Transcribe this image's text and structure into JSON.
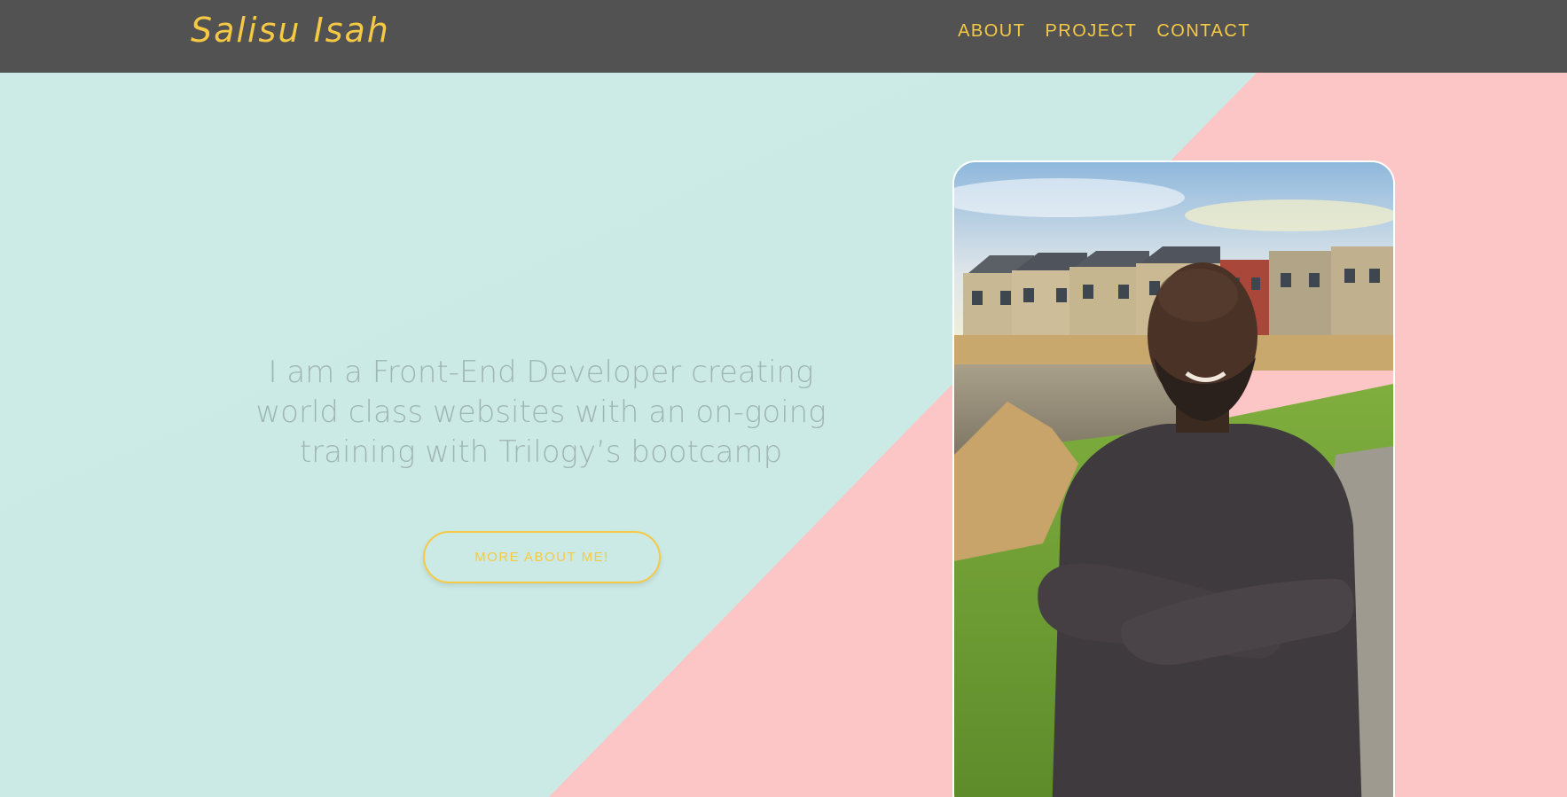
{
  "header": {
    "brand": "Salisu Isah",
    "nav": [
      {
        "label": "ABOUT"
      },
      {
        "label": "PROJECT"
      },
      {
        "label": "CONTACT"
      }
    ]
  },
  "hero": {
    "tagline": "I am a Front-End Developer creating world class websites with an on-going training with Trilogy’s bootcamp",
    "cta_label": "MORE ABOUT ME!",
    "photo_alt": "Portrait photo"
  },
  "colors": {
    "navbar": "#525252",
    "accent": "#f6c945",
    "hero_mint": "#d3eeea",
    "hero_pink": "#fcc5c6",
    "tagline_text": "#9fb5b3"
  }
}
